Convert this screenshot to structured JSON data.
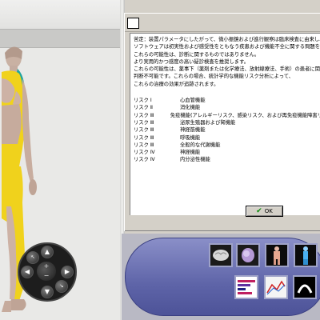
{
  "dialog": {
    "body_lines": [
      "苦定：装置パラメータにしたがって、微小振鏡および進行観察は臨床検査に由来し、",
      "ソフトウェアは初実性および感受性をともなう疾患および機能不全に関する問題を提示します",
      "これらの可能性は、診断に関するものではありません。",
      "より実用的かつ感度の高い疑診検査を推奨します。",
      "これらの可能性は、薬事下（薬剤または化学療法、放射線療法、手術）の患者に関して",
      "判断不可能です。これらの場合、統計学的な機能リスク分析によって、",
      "これらの治療の効果が追跡されます。"
    ],
    "risks": [
      {
        "code": "リスク Ⅰ",
        "label": "心血管機能"
      },
      {
        "code": "リスク Ⅱ",
        "label": "消化機能"
      },
      {
        "code": "リスク Ⅲ",
        "label": "免疫機能(アレルギーリスク、感染リスク、および再免疫機能障害リ"
      },
      {
        "code": "リスク Ⅲ",
        "label": "泌尿生殖器および腎機能"
      },
      {
        "code": "リスク Ⅲ",
        "label": "神経筋機能"
      },
      {
        "code": "リスク Ⅲ",
        "label": "呼吸機能"
      },
      {
        "code": "リスク Ⅲ",
        "label": "全般的な代謝機能"
      },
      {
        "code": "リスク Ⅳ",
        "label": "神経機能"
      },
      {
        "code": "リスク Ⅳ",
        "label": "内分泌性機能"
      }
    ],
    "ok_label": "OK"
  },
  "navigator": {
    "up": "▲",
    "down": "▼",
    "left": "◀",
    "right": "▶",
    "zoom_in": "+",
    "zoom_out": "−"
  },
  "view_buttons": [
    {
      "icon": "brain-icon"
    },
    {
      "icon": "organ-icon"
    },
    {
      "icon": "body-front-icon"
    },
    {
      "icon": "body-side-icon"
    },
    {
      "icon": "spectrum-chart-icon"
    },
    {
      "icon": "graph-chart-icon"
    },
    {
      "icon": "arc-icon"
    }
  ],
  "colors": {
    "risk_highlight": "#f0d21c",
    "risk_secondary": "#1fa5a0",
    "panel_blue": "#5e64a8",
    "ok_check": "#0a8a0a"
  }
}
